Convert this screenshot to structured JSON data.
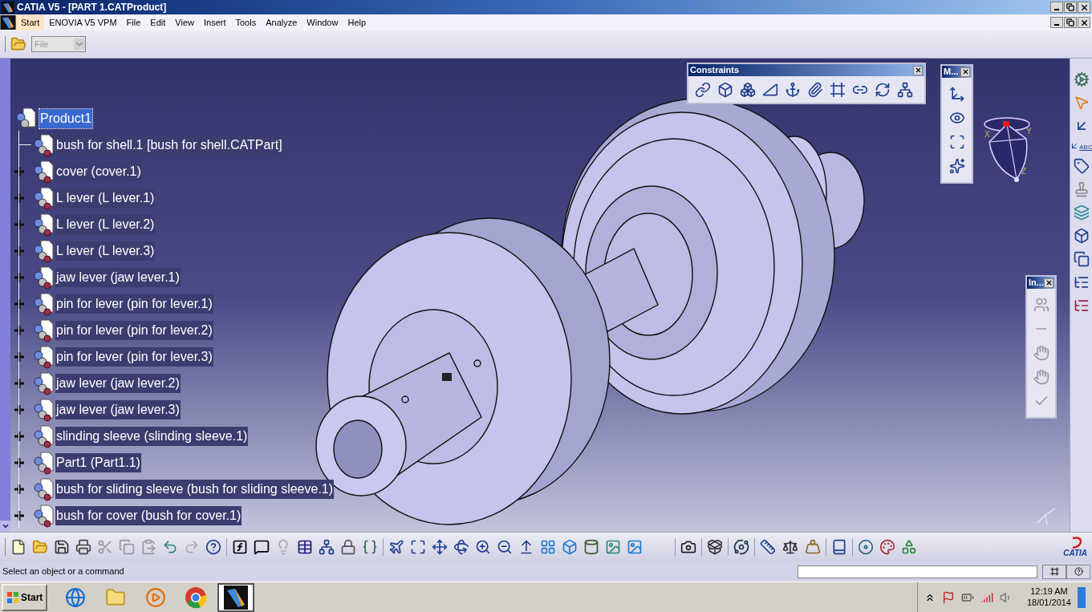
{
  "window": {
    "title": "CATIA V5 - [PART 1.CATProduct]"
  },
  "menu": [
    {
      "label": "Start",
      "selected": true
    },
    {
      "label": "ENOVIA V5 VPM",
      "selected": false
    },
    {
      "label": "File",
      "selected": false
    },
    {
      "label": "Edit",
      "selected": false
    },
    {
      "label": "View",
      "selected": false
    },
    {
      "label": "Insert",
      "selected": false
    },
    {
      "label": "Tools",
      "selected": false
    },
    {
      "label": "Analyze",
      "selected": false
    },
    {
      "label": "Window",
      "selected": false
    },
    {
      "label": "Help",
      "selected": false
    }
  ],
  "workbench_combo": {
    "value": "File",
    "disabled": true
  },
  "tree": {
    "root": {
      "label": "Product1",
      "selected": true
    },
    "children": [
      {
        "label": "bush for shell.1 [bush for shell.CATPart]",
        "kind": "leaf"
      },
      {
        "label": "cover (cover.1)",
        "kind": "collapsed"
      },
      {
        "label": "L lever (L lever.1)",
        "kind": "collapsed"
      },
      {
        "label": "L lever (L lever.2)",
        "kind": "collapsed"
      },
      {
        "label": "L lever (L lever.3)",
        "kind": "collapsed"
      },
      {
        "label": "jaw lever (jaw lever.1)",
        "kind": "collapsed"
      },
      {
        "label": "pin for lever (pin for lever.1)",
        "kind": "collapsed"
      },
      {
        "label": "pin for lever (pin for lever.2)",
        "kind": "collapsed"
      },
      {
        "label": "pin for lever (pin for lever.3)",
        "kind": "collapsed"
      },
      {
        "label": "jaw lever (jaw lever.2)",
        "kind": "collapsed"
      },
      {
        "label": "jaw lever (jaw lever.3)",
        "kind": "collapsed"
      },
      {
        "label": "slinding sleeve (slinding sleeve.1)",
        "kind": "collapsed"
      },
      {
        "label": "Part1 (Part1.1)",
        "kind": "collapsed"
      },
      {
        "label": "bush for sliding sleeve (bush for sliding sleeve.1)",
        "kind": "collapsed"
      },
      {
        "label": "bush for cover (bush for cover.1)",
        "kind": "collapsed"
      }
    ]
  },
  "floating_toolbars": [
    {
      "title": "Constraints",
      "kind": "horizontal"
    },
    {
      "title": "M...",
      "kind": "vertical"
    },
    {
      "title": "In...",
      "kind": "vertical"
    }
  ],
  "compass": {
    "axes": [
      "X",
      "Y",
      "Z"
    ]
  },
  "side_toolbar": {
    "text_icon": "ABC"
  },
  "logo": {
    "text": "CATIA"
  },
  "status_bar": {
    "message": "Select an object or a command"
  },
  "taskbar": {
    "start": "Start",
    "apps": [
      {
        "kind": "browser",
        "selected": false
      },
      {
        "kind": "explorer",
        "selected": false
      },
      {
        "kind": "media",
        "selected": false
      },
      {
        "kind": "chrome",
        "selected": false
      },
      {
        "kind": "catia",
        "selected": true
      }
    ],
    "time": "12:19 AM",
    "date": "18/01/2014"
  }
}
